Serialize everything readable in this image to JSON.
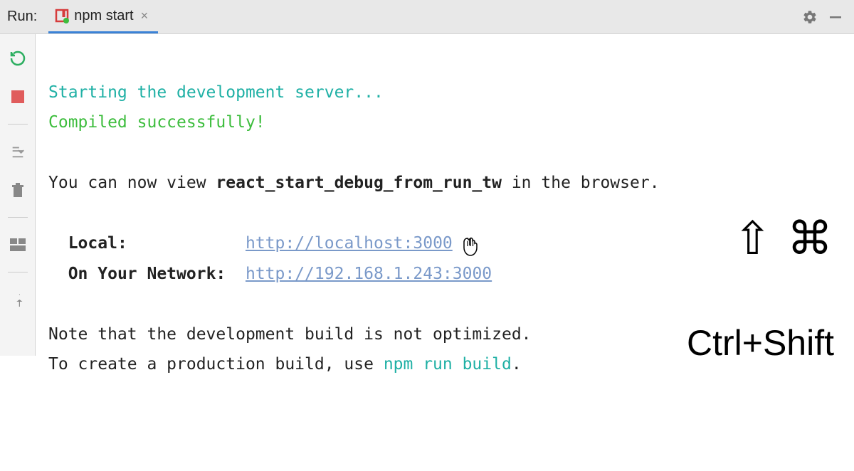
{
  "header": {
    "run_label": "Run:",
    "tab_label": "npm start"
  },
  "console": {
    "line1": "Starting the development server...",
    "line2": "Compiled successfully!",
    "view_prefix": "You can now view ",
    "view_app": "react_start_debug_from_run_tw",
    "view_suffix": " in the browser.",
    "local_label": "Local:",
    "local_url": "http://localhost:3000",
    "network_label": "On Your Network:",
    "network_url": "http://192.168.1.243:3000",
    "note1": "Note that the development build is not optimized.",
    "note2_prefix": "To create a production build, use ",
    "note2_cmd": "npm run build",
    "note2_suffix": "."
  },
  "overlay": {
    "symbols": "⇧ ⌘",
    "text": "Ctrl+Shift"
  }
}
